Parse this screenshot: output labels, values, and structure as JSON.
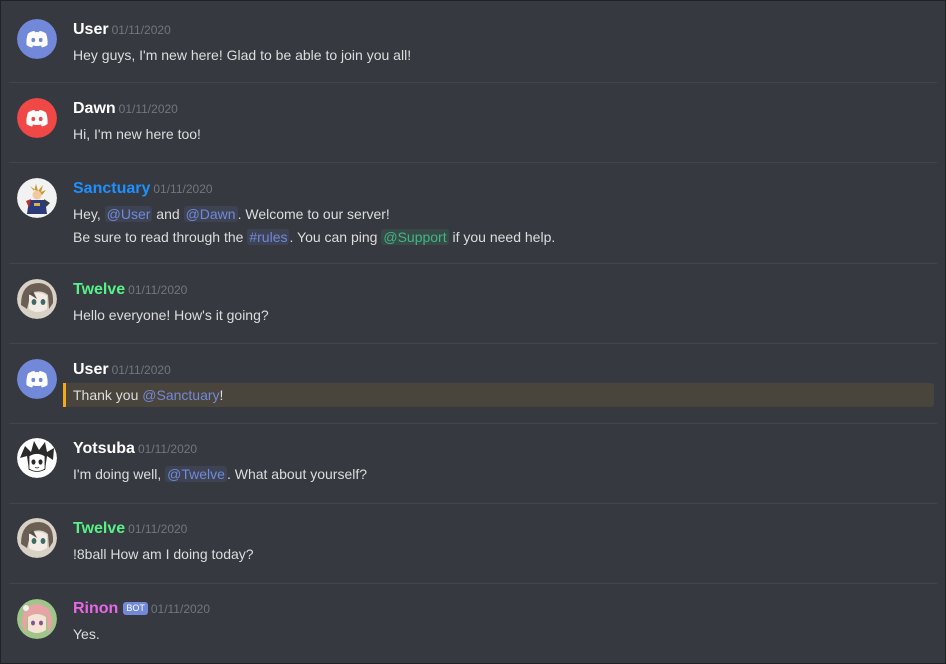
{
  "colors": {
    "background": "#36393f",
    "author_default": "#ffffff",
    "author_sanctuary": "#1e90ff",
    "author_twelve": "#57f287",
    "author_rinon": "#e767e7",
    "mention": "#7289da",
    "role_mention": "#43b581",
    "highlight_border": "#faa61a"
  },
  "messages": [
    {
      "author": "User",
      "timestamp": "01/11/2020",
      "avatar": "discord-blurple-icon",
      "text": "Hey guys, I'm new here! Glad to be able to join you all!"
    },
    {
      "author": "Dawn",
      "timestamp": "01/11/2020",
      "avatar": "discord-red-icon",
      "text": "Hi, I'm new here too!"
    },
    {
      "author": "Sanctuary",
      "timestamp": "01/11/2020",
      "avatar": "character-avatar",
      "line1": {
        "pre": "Hey, ",
        "mention1": "@User",
        "mid": " and ",
        "mention2": "@Dawn",
        "post": ". Welcome to our server!"
      },
      "line2": {
        "pre": "Be sure to read through the ",
        "channel": "#rules",
        "mid": ". You can ping ",
        "role": "@Support",
        "post": " if you need help."
      }
    },
    {
      "author": "Twelve",
      "timestamp": "01/11/2020",
      "avatar": "anime-girl-avatar",
      "text": "Hello everyone! How's it going?"
    },
    {
      "author": "User",
      "timestamp": "01/11/2020",
      "avatar": "discord-blurple-icon",
      "pre": "Thank you ",
      "mention": "@Sanctuary",
      "post": "!"
    },
    {
      "author": "Yotsuba",
      "timestamp": "01/11/2020",
      "avatar": "manga-girl-avatar",
      "pre": "I'm doing well, ",
      "mention": "@Twelve",
      "post": ". What about yourself?"
    },
    {
      "author": "Twelve",
      "timestamp": "01/11/2020",
      "avatar": "anime-girl-avatar",
      "text": "!8ball How am I doing today?"
    },
    {
      "author": "Rinon",
      "bot_tag": "BOT",
      "timestamp": "01/11/2020",
      "avatar": "pink-hair-girl-avatar",
      "text": "Yes."
    }
  ]
}
